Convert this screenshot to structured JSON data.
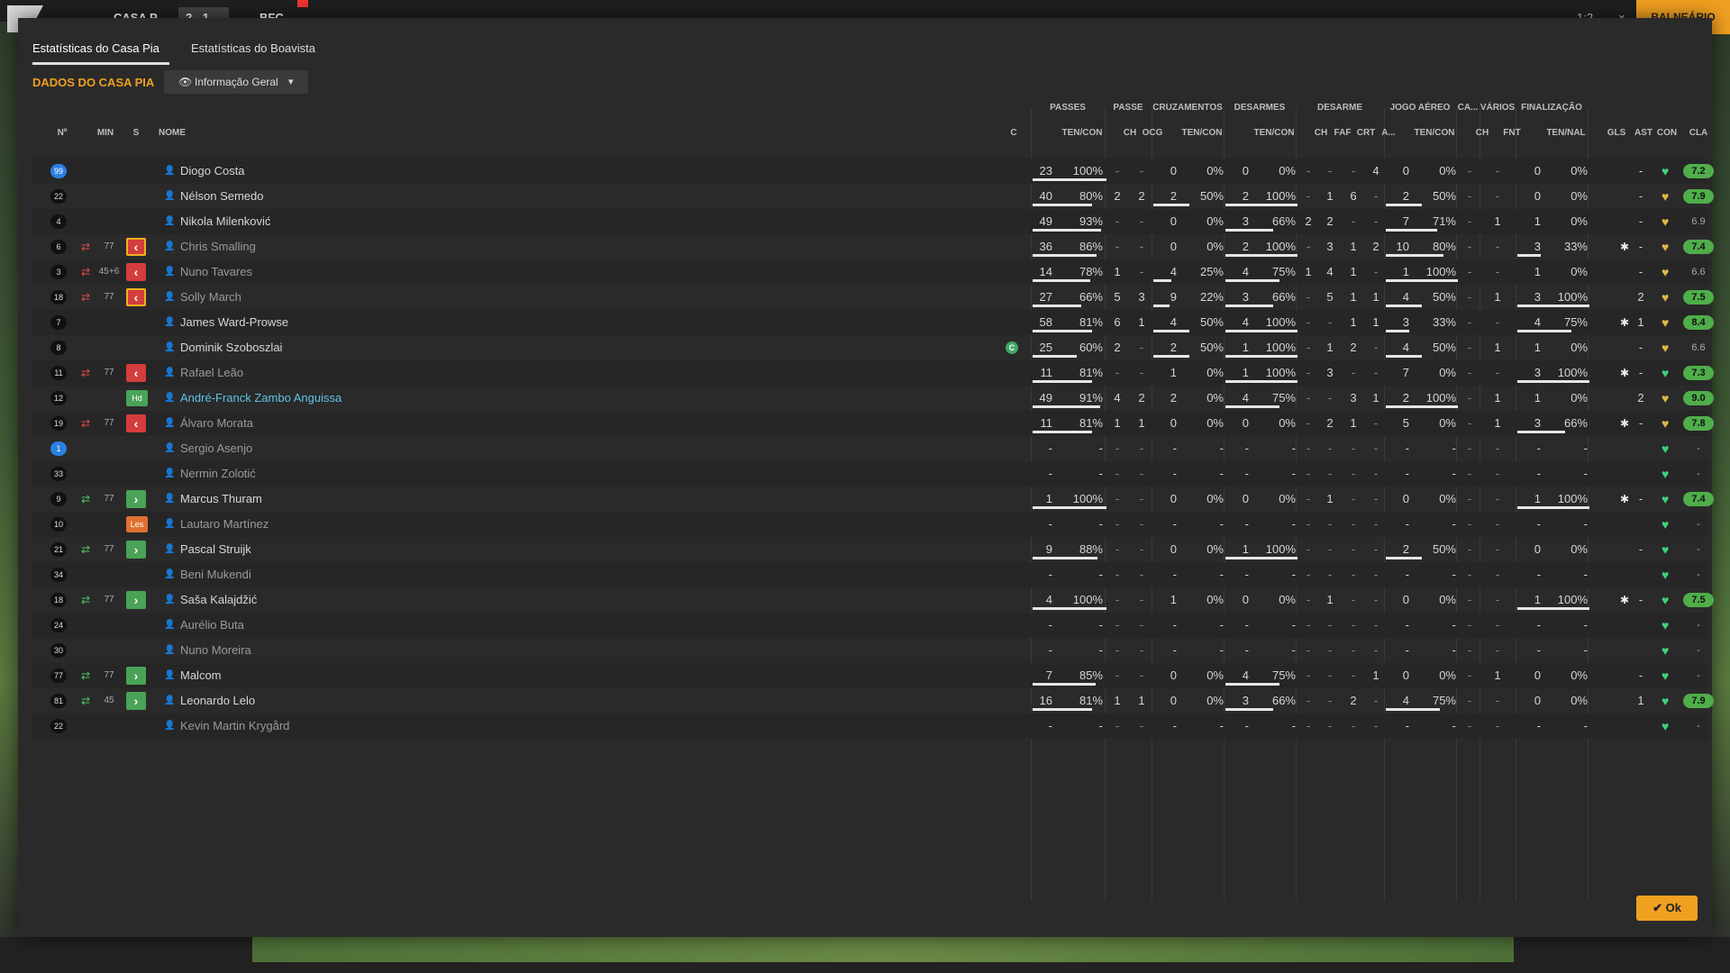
{
  "topbar": {
    "home_team": "CASA P",
    "score": "2 - 1",
    "away_team": "BFC",
    "right_button": "BALNEÁRIO",
    "ctl1": "1:2",
    "ctl2": "×"
  },
  "tabs": [
    {
      "label": "Estatísticas do Casa Pia"
    },
    {
      "label": "Estatísticas do Boavista"
    }
  ],
  "section_title": "DADOS DO CASA PIA",
  "dropdown": {
    "label": "Informação Geral",
    "icon": "eye-icon"
  },
  "ok_label": "Ok",
  "group_headers": {
    "passes": "PASSES",
    "passe": "PASSE",
    "cruzamentos": "CRUZAMENTOS",
    "desarmes": "DESARMES",
    "desarme": "DESARME",
    "jogo_aereo": "JOGO AÉREO",
    "ca": "CA...",
    "varios": "VÁRIOS",
    "finalizacao": "FINALIZAÇÃO"
  },
  "col_headers": {
    "no": "Nº",
    "min": "MIN",
    "s": "S",
    "nome": "NOME",
    "c": "C",
    "pas_tc": "TEN/CON",
    "pch": "CH",
    "pocg": "OCG",
    "cz_tc": "TEN/CON",
    "ds_tc": "TEN/CON",
    "dch": "CH",
    "dfaf": "FAF",
    "dcrt": "CRT",
    "da": "A...",
    "ja_tc": "TEN/CON",
    "cach": "CH",
    "fnt": "FNT",
    "fin_tn": "TEN/NAL",
    "gls": "GLS",
    "ast": "AST",
    "con": "CON",
    "cla": "CLA"
  },
  "players": [
    {
      "no": "99",
      "gk": true,
      "min": "",
      "swap": "",
      "sub": "",
      "name": "Diogo Costa",
      "hl": false,
      "dim": false,
      "cap": false,
      "pt": "23",
      "pp": "100%",
      "pbar": 1.0,
      "pch": "-",
      "pocg": "-",
      "ct": "0",
      "cp": "0%",
      "cbar": 0,
      "dt": "0",
      "dp": "0%",
      "dbar": 0,
      "dch": "-",
      "faf": "-",
      "crt": "-",
      "da": "4",
      "jt": "0",
      "jp": "0%",
      "jbar": 0,
      "cach": "-",
      "fnt": "-",
      "ft": "0",
      "fp": "0%",
      "fbar": 0,
      "gear": false,
      "ast": "-",
      "gls": "",
      "heart": "g",
      "rating": "7.2",
      "rc": "g"
    },
    {
      "no": "22",
      "gk": false,
      "min": "",
      "swap": "",
      "sub": "",
      "name": "Nélson Semedo",
      "hl": false,
      "dim": false,
      "cap": false,
      "pt": "40",
      "pp": "80%",
      "pbar": 0.8,
      "pch": "2",
      "pocg": "2",
      "ct": "2",
      "cp": "50%",
      "cbar": 0.5,
      "dt": "2",
      "dp": "100%",
      "dbar": 1.0,
      "dch": "-",
      "faf": "1",
      "crt": "6",
      "da": "-",
      "jt": "2",
      "jp": "50%",
      "jbar": 0.5,
      "cach": "-",
      "fnt": "-",
      "ft": "0",
      "fp": "0%",
      "fbar": 0,
      "gear": false,
      "ast": "-",
      "gls": "",
      "heart": "y",
      "rating": "7.9",
      "rc": "g"
    },
    {
      "no": "4",
      "gk": false,
      "min": "",
      "swap": "",
      "sub": "",
      "name": "Nikola Milenković",
      "hl": false,
      "dim": false,
      "cap": false,
      "pt": "49",
      "pp": "93%",
      "pbar": 0.93,
      "pch": "-",
      "pocg": "-",
      "ct": "0",
      "cp": "0%",
      "cbar": 0,
      "dt": "3",
      "dp": "66%",
      "dbar": 0.66,
      "dch": "2",
      "faf": "2",
      "crt": "-",
      "da": "-",
      "jt": "7",
      "jp": "71%",
      "jbar": 0.71,
      "cach": "-",
      "fnt": "1",
      "ft": "1",
      "fp": "0%",
      "fbar": 0,
      "gear": false,
      "ast": "-",
      "gls": "",
      "heart": "y",
      "rating": "6.9",
      "rc": "n"
    },
    {
      "no": "6",
      "gk": false,
      "min": "77",
      "swap": "out",
      "sub": "offy",
      "name": "Chris Smalling",
      "hl": false,
      "dim": true,
      "cap": false,
      "pt": "36",
      "pp": "86%",
      "pbar": 0.86,
      "pch": "-",
      "pocg": "-",
      "ct": "0",
      "cp": "0%",
      "cbar": 0,
      "dt": "2",
      "dp": "100%",
      "dbar": 1.0,
      "dch": "-",
      "faf": "3",
      "crt": "1",
      "da": "2",
      "jt": "10",
      "jp": "80%",
      "jbar": 0.8,
      "cach": "-",
      "fnt": "-",
      "ft": "3",
      "fp": "33%",
      "fbar": 0.33,
      "gear": true,
      "ast": "-",
      "gls": "",
      "heart": "y",
      "rating": "7.4",
      "rc": "g"
    },
    {
      "no": "3",
      "gk": false,
      "min": "45+6",
      "swap": "out",
      "sub": "off",
      "name": "Nuno Tavares",
      "hl": false,
      "dim": true,
      "cap": false,
      "pt": "14",
      "pp": "78%",
      "pbar": 0.78,
      "pch": "1",
      "pocg": "-",
      "ct": "4",
      "cp": "25%",
      "cbar": 0.25,
      "dt": "4",
      "dp": "75%",
      "dbar": 0.75,
      "dch": "1",
      "faf": "4",
      "crt": "1",
      "da": "-",
      "jt": "1",
      "jp": "100%",
      "jbar": 1.0,
      "cach": "-",
      "fnt": "-",
      "ft": "1",
      "fp": "0%",
      "fbar": 0,
      "gear": false,
      "ast": "-",
      "gls": "",
      "heart": "y",
      "rating": "6.6",
      "rc": "n"
    },
    {
      "no": "18",
      "gk": false,
      "min": "77",
      "swap": "out",
      "sub": "offy",
      "name": "Solly March",
      "hl": false,
      "dim": true,
      "cap": false,
      "pt": "27",
      "pp": "66%",
      "pbar": 0.66,
      "pch": "5",
      "pocg": "3",
      "ct": "9",
      "cp": "22%",
      "cbar": 0.22,
      "dt": "3",
      "dp": "66%",
      "dbar": 0.66,
      "dch": "-",
      "faf": "5",
      "crt": "1",
      "da": "1",
      "jt": "4",
      "jp": "50%",
      "jbar": 0.5,
      "cach": "-",
      "fnt": "1",
      "ft": "3",
      "fp": "100%",
      "fbar": 1.0,
      "gear": false,
      "ast": "2",
      "gls": "",
      "heart": "y",
      "rating": "7.5",
      "rc": "g"
    },
    {
      "no": "7",
      "gk": false,
      "min": "",
      "swap": "",
      "sub": "",
      "name": "James Ward-Prowse",
      "hl": false,
      "dim": false,
      "cap": false,
      "pt": "58",
      "pp": "81%",
      "pbar": 0.81,
      "pch": "6",
      "pocg": "1",
      "ct": "4",
      "cp": "50%",
      "cbar": 0.5,
      "dt": "4",
      "dp": "100%",
      "dbar": 1.0,
      "dch": "-",
      "faf": "-",
      "crt": "1",
      "da": "1",
      "jt": "3",
      "jp": "33%",
      "jbar": 0.33,
      "cach": "-",
      "fnt": "-",
      "ft": "4",
      "fp": "75%",
      "fbar": 0.75,
      "gear": true,
      "ast": "1",
      "gls": "",
      "heart": "y",
      "rating": "8.4",
      "rc": "g"
    },
    {
      "no": "8",
      "gk": false,
      "min": "",
      "swap": "",
      "sub": "",
      "name": "Dominik Szoboszlai",
      "hl": false,
      "dim": false,
      "cap": true,
      "pt": "25",
      "pp": "60%",
      "pbar": 0.6,
      "pch": "2",
      "pocg": "-",
      "ct": "2",
      "cp": "50%",
      "cbar": 0.5,
      "dt": "1",
      "dp": "100%",
      "dbar": 1.0,
      "dch": "-",
      "faf": "1",
      "crt": "2",
      "da": "-",
      "jt": "4",
      "jp": "50%",
      "jbar": 0.5,
      "cach": "-",
      "fnt": "1",
      "ft": "1",
      "fp": "0%",
      "fbar": 0,
      "gear": false,
      "ast": "-",
      "gls": "",
      "heart": "y",
      "rating": "6.6",
      "rc": "n"
    },
    {
      "no": "11",
      "gk": false,
      "min": "77",
      "swap": "out",
      "sub": "off",
      "name": "Rafael Leão",
      "hl": false,
      "dim": true,
      "cap": false,
      "pt": "11",
      "pp": "81%",
      "pbar": 0.81,
      "pch": "-",
      "pocg": "-",
      "ct": "1",
      "cp": "0%",
      "cbar": 0,
      "dt": "1",
      "dp": "100%",
      "dbar": 1.0,
      "dch": "-",
      "faf": "3",
      "crt": "-",
      "da": "-",
      "jt": "7",
      "jp": "0%",
      "jbar": 0,
      "cach": "-",
      "fnt": "-",
      "ft": "3",
      "fp": "100%",
      "fbar": 1.0,
      "gear": true,
      "ast": "-",
      "gls": "",
      "heart": "g",
      "rating": "7.3",
      "rc": "g"
    },
    {
      "no": "12",
      "gk": false,
      "min": "",
      "swap": "",
      "sub": "hd",
      "name": "André-Franck Zambo Anguissa",
      "hl": true,
      "dim": false,
      "cap": false,
      "pt": "49",
      "pp": "91%",
      "pbar": 0.91,
      "pch": "4",
      "pocg": "2",
      "ct": "2",
      "cp": "0%",
      "cbar": 0,
      "dt": "4",
      "dp": "75%",
      "dbar": 0.75,
      "dch": "-",
      "faf": "-",
      "crt": "3",
      "da": "1",
      "jt": "2",
      "jp": "100%",
      "jbar": 1.0,
      "cach": "-",
      "fnt": "1",
      "ft": "1",
      "fp": "0%",
      "fbar": 0,
      "gear": false,
      "ast": "2",
      "gls": "",
      "heart": "y",
      "rating": "9.0",
      "rc": "g"
    },
    {
      "no": "19",
      "gk": false,
      "min": "77",
      "swap": "out",
      "sub": "off",
      "name": "Álvaro Morata",
      "hl": false,
      "dim": true,
      "cap": false,
      "pt": "11",
      "pp": "81%",
      "pbar": 0.81,
      "pch": "1",
      "pocg": "1",
      "ct": "0",
      "cp": "0%",
      "cbar": 0,
      "dt": "0",
      "dp": "0%",
      "dbar": 0,
      "dch": "-",
      "faf": "2",
      "crt": "1",
      "da": "-",
      "jt": "5",
      "jp": "0%",
      "jbar": 0,
      "cach": "-",
      "fnt": "1",
      "ft": "3",
      "fp": "66%",
      "fbar": 0.66,
      "gear": true,
      "ast": "-",
      "gls": "",
      "heart": "y",
      "rating": "7.8",
      "rc": "g"
    },
    {
      "no": "1",
      "gk": true,
      "min": "",
      "swap": "",
      "sub": "",
      "name": "Sergio Asenjo",
      "hl": false,
      "dim": true,
      "cap": false,
      "pt": "-",
      "pp": "-",
      "pbar": 0,
      "pch": "-",
      "pocg": "-",
      "ct": "-",
      "cp": "-",
      "cbar": 0,
      "dt": "-",
      "dp": "-",
      "dbar": 0,
      "dch": "-",
      "faf": "-",
      "crt": "-",
      "da": "-",
      "jt": "-",
      "jp": "-",
      "jbar": 0,
      "cach": "-",
      "fnt": "-",
      "ft": "-",
      "fp": "-",
      "fbar": 0,
      "gear": false,
      "ast": "",
      "gls": "",
      "heart": "g",
      "rating": "-",
      "rc": "n"
    },
    {
      "no": "33",
      "gk": false,
      "min": "",
      "swap": "",
      "sub": "",
      "name": "Nermin Zolotić",
      "hl": false,
      "dim": true,
      "cap": false,
      "pt": "-",
      "pp": "-",
      "pbar": 0,
      "pch": "-",
      "pocg": "-",
      "ct": "-",
      "cp": "-",
      "cbar": 0,
      "dt": "-",
      "dp": "-",
      "dbar": 0,
      "dch": "-",
      "faf": "-",
      "crt": "-",
      "da": "-",
      "jt": "-",
      "jp": "-",
      "jbar": 0,
      "cach": "-",
      "fnt": "-",
      "ft": "-",
      "fp": "-",
      "fbar": 0,
      "gear": false,
      "ast": "",
      "gls": "",
      "heart": "g",
      "rating": "-",
      "rc": "n"
    },
    {
      "no": "9",
      "gk": false,
      "min": "77",
      "swap": "in",
      "sub": "on",
      "name": "Marcus Thuram",
      "hl": false,
      "dim": false,
      "cap": false,
      "pt": "1",
      "pp": "100%",
      "pbar": 1.0,
      "pch": "-",
      "pocg": "-",
      "ct": "0",
      "cp": "0%",
      "cbar": 0,
      "dt": "0",
      "dp": "0%",
      "dbar": 0,
      "dch": "-",
      "faf": "1",
      "crt": "-",
      "da": "-",
      "jt": "0",
      "jp": "0%",
      "jbar": 0,
      "cach": "-",
      "fnt": "-",
      "ft": "1",
      "fp": "100%",
      "fbar": 1.0,
      "gear": true,
      "ast": "-",
      "gls": "",
      "heart": "g",
      "rating": "7.4",
      "rc": "g"
    },
    {
      "no": "10",
      "gk": false,
      "min": "",
      "swap": "",
      "sub": "les",
      "name": "Lautaro Martínez",
      "hl": false,
      "dim": true,
      "cap": false,
      "pt": "-",
      "pp": "-",
      "pbar": 0,
      "pch": "-",
      "pocg": "-",
      "ct": "-",
      "cp": "-",
      "cbar": 0,
      "dt": "-",
      "dp": "-",
      "dbar": 0,
      "dch": "-",
      "faf": "-",
      "crt": "-",
      "da": "-",
      "jt": "-",
      "jp": "-",
      "jbar": 0,
      "cach": "-",
      "fnt": "-",
      "ft": "-",
      "fp": "-",
      "fbar": 0,
      "gear": false,
      "ast": "",
      "gls": "",
      "heart": "g",
      "rating": "-",
      "rc": "n"
    },
    {
      "no": "21",
      "gk": false,
      "min": "77",
      "swap": "in",
      "sub": "on",
      "name": "Pascal Struijk",
      "hl": false,
      "dim": false,
      "cap": false,
      "pt": "9",
      "pp": "88%",
      "pbar": 0.88,
      "pch": "-",
      "pocg": "-",
      "ct": "0",
      "cp": "0%",
      "cbar": 0,
      "dt": "1",
      "dp": "100%",
      "dbar": 1.0,
      "dch": "-",
      "faf": "-",
      "crt": "-",
      "da": "-",
      "jt": "2",
      "jp": "50%",
      "jbar": 0.5,
      "cach": "-",
      "fnt": "-",
      "ft": "0",
      "fp": "0%",
      "fbar": 0,
      "gear": false,
      "ast": "-",
      "gls": "",
      "heart": "g",
      "rating": "-",
      "rc": "n"
    },
    {
      "no": "34",
      "gk": false,
      "min": "",
      "swap": "",
      "sub": "",
      "name": "Beni Mukendi",
      "hl": false,
      "dim": true,
      "cap": false,
      "pt": "-",
      "pp": "-",
      "pbar": 0,
      "pch": "-",
      "pocg": "-",
      "ct": "-",
      "cp": "-",
      "cbar": 0,
      "dt": "-",
      "dp": "-",
      "dbar": 0,
      "dch": "-",
      "faf": "-",
      "crt": "-",
      "da": "-",
      "jt": "-",
      "jp": "-",
      "jbar": 0,
      "cach": "-",
      "fnt": "-",
      "ft": "-",
      "fp": "-",
      "fbar": 0,
      "gear": false,
      "ast": "",
      "gls": "",
      "heart": "g",
      "rating": "-",
      "rc": "n"
    },
    {
      "no": "18",
      "gk": false,
      "min": "77",
      "swap": "in",
      "sub": "on",
      "name": "Saša Kalajdžić",
      "hl": false,
      "dim": false,
      "cap": false,
      "pt": "4",
      "pp": "100%",
      "pbar": 1.0,
      "pch": "-",
      "pocg": "-",
      "ct": "1",
      "cp": "0%",
      "cbar": 0,
      "dt": "0",
      "dp": "0%",
      "dbar": 0,
      "dch": "-",
      "faf": "1",
      "crt": "-",
      "da": "-",
      "jt": "0",
      "jp": "0%",
      "jbar": 0,
      "cach": "-",
      "fnt": "-",
      "ft": "1",
      "fp": "100%",
      "fbar": 1.0,
      "gear": true,
      "ast": "-",
      "gls": "",
      "heart": "g",
      "rating": "7.5",
      "rc": "g"
    },
    {
      "no": "24",
      "gk": false,
      "min": "",
      "swap": "",
      "sub": "",
      "name": "Aurélio Buta",
      "hl": false,
      "dim": true,
      "cap": false,
      "pt": "-",
      "pp": "-",
      "pbar": 0,
      "pch": "-",
      "pocg": "-",
      "ct": "-",
      "cp": "-",
      "cbar": 0,
      "dt": "-",
      "dp": "-",
      "dbar": 0,
      "dch": "-",
      "faf": "-",
      "crt": "-",
      "da": "-",
      "jt": "-",
      "jp": "-",
      "jbar": 0,
      "cach": "-",
      "fnt": "-",
      "ft": "-",
      "fp": "-",
      "fbar": 0,
      "gear": false,
      "ast": "",
      "gls": "",
      "heart": "g",
      "rating": "-",
      "rc": "n"
    },
    {
      "no": "30",
      "gk": false,
      "min": "",
      "swap": "",
      "sub": "",
      "name": "Nuno Moreira",
      "hl": false,
      "dim": true,
      "cap": false,
      "pt": "-",
      "pp": "-",
      "pbar": 0,
      "pch": "-",
      "pocg": "-",
      "ct": "-",
      "cp": "-",
      "cbar": 0,
      "dt": "-",
      "dp": "-",
      "dbar": 0,
      "dch": "-",
      "faf": "-",
      "crt": "-",
      "da": "-",
      "jt": "-",
      "jp": "-",
      "jbar": 0,
      "cach": "-",
      "fnt": "-",
      "ft": "-",
      "fp": "-",
      "fbar": 0,
      "gear": false,
      "ast": "",
      "gls": "",
      "heart": "g",
      "rating": "-",
      "rc": "n"
    },
    {
      "no": "77",
      "gk": false,
      "min": "77",
      "swap": "in",
      "sub": "on",
      "name": "Malcom",
      "hl": false,
      "dim": false,
      "cap": false,
      "pt": "7",
      "pp": "85%",
      "pbar": 0.85,
      "pch": "-",
      "pocg": "-",
      "ct": "0",
      "cp": "0%",
      "cbar": 0,
      "dt": "4",
      "dp": "75%",
      "dbar": 0.75,
      "dch": "-",
      "faf": "-",
      "crt": "-",
      "da": "1",
      "jt": "0",
      "jp": "0%",
      "jbar": 0,
      "cach": "-",
      "fnt": "1",
      "ft": "0",
      "fp": "0%",
      "fbar": 0,
      "gear": false,
      "ast": "-",
      "gls": "",
      "heart": "g",
      "rating": "-",
      "rc": "n"
    },
    {
      "no": "81",
      "gk": false,
      "min": "45",
      "swap": "in",
      "sub": "on",
      "name": "Leonardo Lelo",
      "hl": false,
      "dim": false,
      "cap": false,
      "pt": "16",
      "pp": "81%",
      "pbar": 0.81,
      "pch": "1",
      "pocg": "1",
      "ct": "0",
      "cp": "0%",
      "cbar": 0,
      "dt": "3",
      "dp": "66%",
      "dbar": 0.66,
      "dch": "-",
      "faf": "-",
      "crt": "2",
      "da": "-",
      "jt": "4",
      "jp": "75%",
      "jbar": 0.75,
      "cach": "-",
      "fnt": "-",
      "ft": "0",
      "fp": "0%",
      "fbar": 0,
      "gear": false,
      "ast": "1",
      "gls": "",
      "heart": "g",
      "rating": "7.9",
      "rc": "g"
    },
    {
      "no": "22",
      "gk": false,
      "min": "",
      "swap": "",
      "sub": "",
      "name": "Kevin Martin Krygård",
      "hl": false,
      "dim": true,
      "cap": false,
      "pt": "-",
      "pp": "-",
      "pbar": 0,
      "pch": "-",
      "pocg": "-",
      "ct": "-",
      "cp": "-",
      "cbar": 0,
      "dt": "-",
      "dp": "-",
      "dbar": 0,
      "dch": "-",
      "faf": "-",
      "crt": "-",
      "da": "-",
      "jt": "-",
      "jp": "-",
      "jbar": 0,
      "cach": "-",
      "fnt": "-",
      "ft": "-",
      "fp": "-",
      "fbar": 0,
      "gear": false,
      "ast": "",
      "gls": "",
      "heart": "g",
      "rating": "-",
      "rc": "n"
    }
  ]
}
